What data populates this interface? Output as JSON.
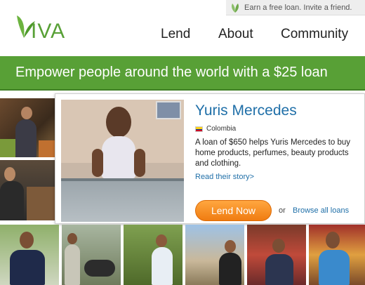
{
  "invite": {
    "text": "Earn a free loan. Invite a friend."
  },
  "brand": {
    "logo_text": "KIVA",
    "green": "#58a036"
  },
  "nav": {
    "lend": "Lend",
    "about": "About",
    "community": "Community"
  },
  "banner": {
    "headline": "Empower people around the world with a $25 loan"
  },
  "featured": {
    "name": "Yuris Mercedes",
    "country": "Colombia",
    "description": "A loan of $650 helps Yuris Mercedes to buy home products, perfumes, beauty products and clothing.",
    "story_link": "Read their story>",
    "lend_button": "Lend Now",
    "or_text": "or",
    "browse_link": "Browse all loans"
  }
}
